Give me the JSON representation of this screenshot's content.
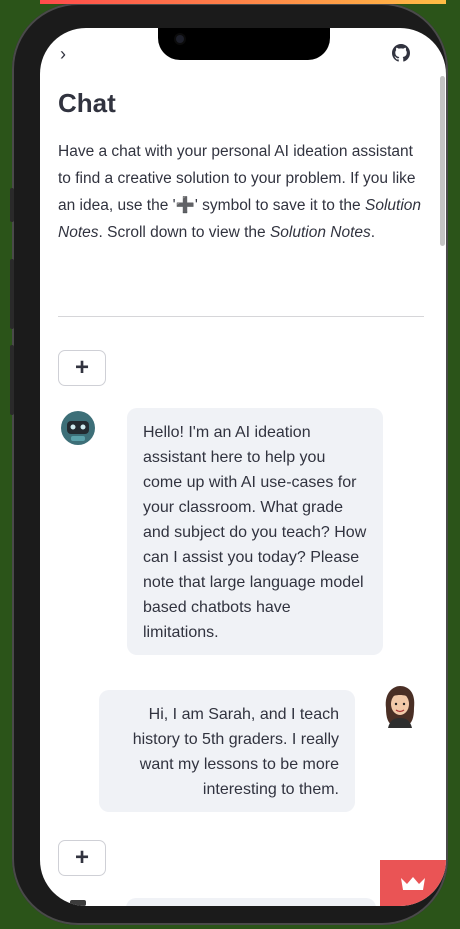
{
  "header": {
    "title": "Chat"
  },
  "nav": {
    "collapse_icon": "chevron-right-icon",
    "github_icon": "github-icon"
  },
  "description": {
    "p1": "Have a chat with your personal AI ideation assistant to find a creative solution to your problem. If you like an idea, use the '",
    "symbol": "➕",
    "p2": "' symbol to save it to the ",
    "em1": "Solution Notes",
    "p3": ". Scroll down to view the ",
    "em2": "Solution Notes",
    "p4": "."
  },
  "actions": {
    "add_label": "+"
  },
  "messages": [
    {
      "role": "assistant",
      "text": "Hello! I'm an AI ideation assistant here to help you come up with AI use-cases for your classroom. What grade and subject do you teach? How can I assist you today? Please note that large language model based chatbots have limitations."
    },
    {
      "role": "user",
      "text": "Hi, I am Sarah, and I teach history to 5th graders. I really want my lessons to be more interesting to them."
    }
  ],
  "colors": {
    "accent": "#ff4b4b",
    "fab": "#ea5455",
    "bubble": "#f0f2f6",
    "background": "#2b5419"
  },
  "icons": {
    "fab": "crown-icon",
    "bot": "robot-avatar-icon",
    "user": "user-avatar-icon"
  }
}
